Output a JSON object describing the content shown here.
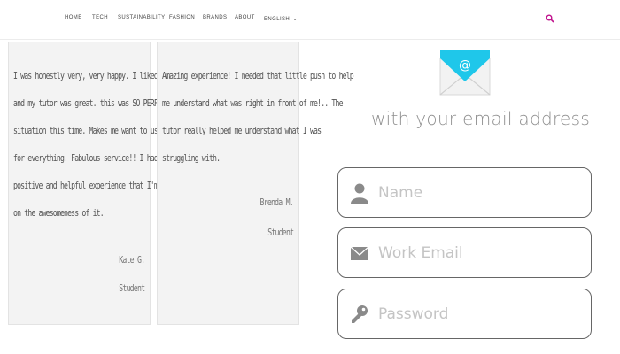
{
  "nav": {
    "items": [
      "HOME",
      "TECH",
      "SUSTAINABILITY",
      "FASHION",
      "BRANDS",
      "ABOUT"
    ],
    "language": "ENGLISH",
    "icons": {
      "language_dropdown": "chevron-down-icon",
      "search": "search-icon"
    },
    "accent_color": "#c0128d"
  },
  "testimonials": [
    {
      "lines": [
        "I was honestly very, very happy. I liked the format,",
        "and my tutor was great. this was SO PERFECT for my",
        "situation this time. Makes me want to use Study.com",
        "for everything. Fabulous service!! I had such a",
        "positive and helpful experience that I'm riding high",
        "on the awesomeness of it."
      ],
      "author": "Kate G.",
      "role": "Student"
    },
    {
      "lines": [
        "Amazing experience! I needed that little push to help",
        "me understand what was right in front of me!.. The",
        "tutor really helped me understand what I was",
        "struggling with."
      ],
      "author": "Brenda M.",
      "role": "Student"
    }
  ],
  "signup": {
    "heading": "with your email address",
    "mail_icon": "email-envelope-icon",
    "fields": [
      {
        "placeholder": "Name",
        "icon": "user-icon"
      },
      {
        "placeholder": "Work Email",
        "icon": "envelope-icon"
      },
      {
        "placeholder": "Password",
        "icon": "key-icon"
      }
    ]
  },
  "colors": {
    "mail_icon": "#1fc7ea",
    "field_icon": "#8a8a8a",
    "card_bg": "#f3f3f3"
  }
}
